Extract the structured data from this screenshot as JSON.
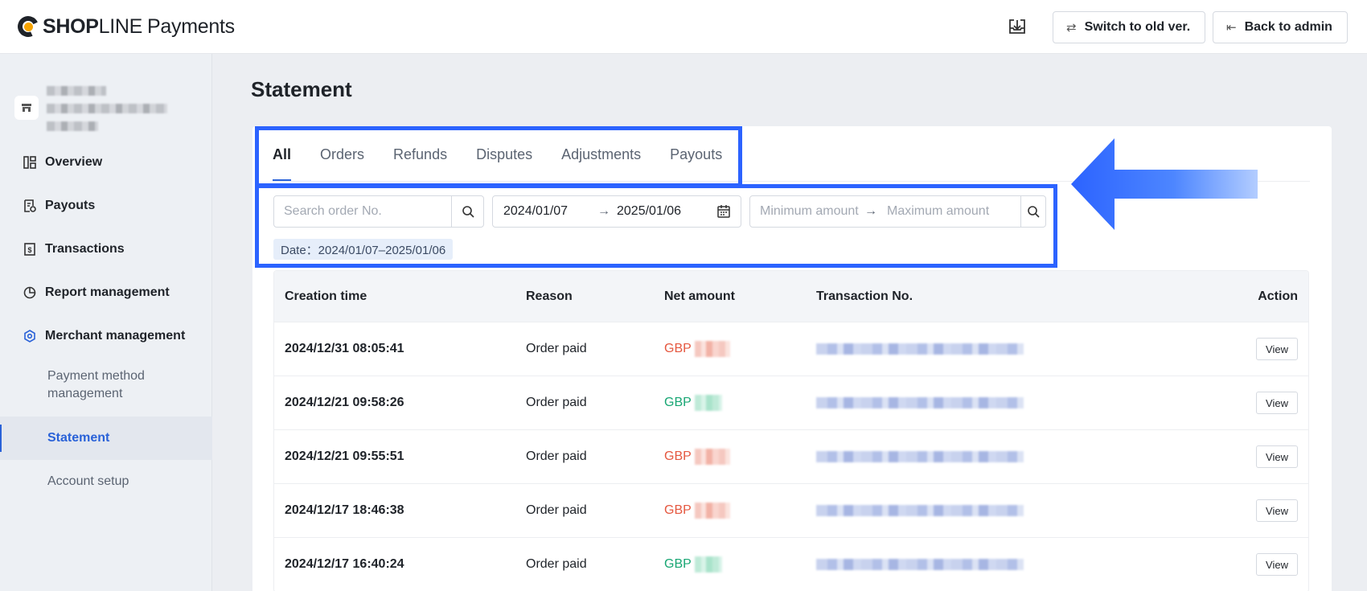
{
  "brand": {
    "name_bold": "SHOP",
    "name_light": "LINE",
    "product": "Payments"
  },
  "header": {
    "export_icon": "download-tray-icon",
    "switch_label": "Switch to old ver.",
    "back_label": "Back to admin"
  },
  "sidebar": {
    "items": [
      {
        "label": "Overview",
        "icon": "grid-icon"
      },
      {
        "label": "Payouts",
        "icon": "receipt-icon"
      },
      {
        "label": "Transactions",
        "icon": "dollar-doc-icon"
      },
      {
        "label": "Report management",
        "icon": "pie-chart-icon"
      },
      {
        "label": "Merchant management",
        "icon": "hexagon-gear-icon"
      }
    ],
    "sub_items": [
      {
        "label": "Payment method management"
      },
      {
        "label": "Statement",
        "active": true
      },
      {
        "label": "Account setup"
      }
    ]
  },
  "page": {
    "title": "Statement"
  },
  "tabs": [
    {
      "label": "All",
      "active": true
    },
    {
      "label": "Orders"
    },
    {
      "label": "Refunds"
    },
    {
      "label": "Disputes"
    },
    {
      "label": "Adjustments"
    },
    {
      "label": "Payouts"
    }
  ],
  "filters": {
    "search_placeholder": "Search order No.",
    "date_start": "2024/01/07",
    "date_sep": "→",
    "date_end": "2025/01/06",
    "min_placeholder": "Minimum amount",
    "amount_sep": "→",
    "max_placeholder": "Maximum amount",
    "tag": "Date：2024/01/07–2025/01/06"
  },
  "table": {
    "columns": [
      "Creation time",
      "Reason",
      "Net amount",
      "Transaction No.",
      "Action"
    ],
    "rows": [
      {
        "time": "2024/12/31 08:05:41",
        "reason": "Order paid",
        "currency": "GBP",
        "sign": "neg",
        "action": "View"
      },
      {
        "time": "2024/12/21 09:58:26",
        "reason": "Order paid",
        "currency": "GBP",
        "sign": "pos",
        "action": "View"
      },
      {
        "time": "2024/12/21 09:55:51",
        "reason": "Order paid",
        "currency": "GBP",
        "sign": "neg",
        "action": "View"
      },
      {
        "time": "2024/12/17 18:46:38",
        "reason": "Order paid",
        "currency": "GBP",
        "sign": "neg",
        "action": "View"
      },
      {
        "time": "2024/12/17 16:40:24",
        "reason": "Order paid",
        "currency": "GBP",
        "sign": "pos",
        "action": "View"
      }
    ]
  },
  "colors": {
    "accent": "#2a62d8",
    "highlight": "#2c63ff",
    "negative": "#e5573f",
    "positive": "#17a673"
  }
}
